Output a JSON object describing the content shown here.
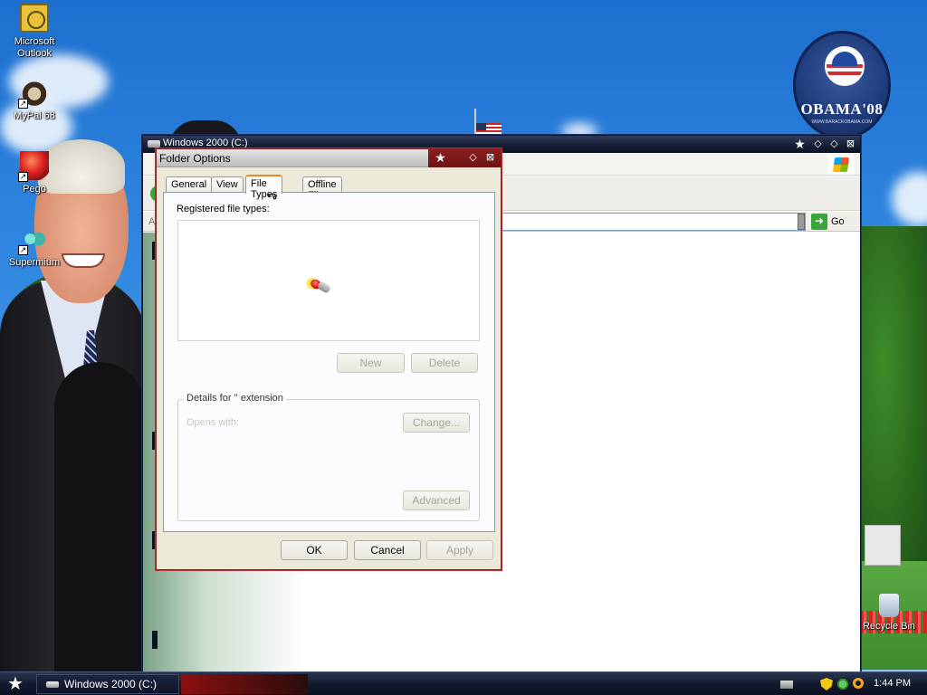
{
  "desktop": {
    "icons": [
      {
        "label": "Microsoft\nOutlook",
        "icon": "outlook-icon"
      },
      {
        "label": "MyPal 68",
        "icon": "mypal-icon"
      },
      {
        "label": "Pego",
        "icon": "pego-icon"
      },
      {
        "label": "Supermium",
        "icon": "supermium-icon"
      },
      {
        "label": "Recycle Bin",
        "icon": "recycle-bin-icon"
      }
    ],
    "badge": {
      "text": "OBAMA'08",
      "sub": "WWW.BARACKOBAMA.COM"
    }
  },
  "explorer": {
    "title": "Windows 2000 (C:)",
    "address_label": "Ad",
    "go_label": "Go"
  },
  "dialog": {
    "title": "Folder Options",
    "tabs": [
      "General",
      "View",
      "File Types",
      "Offline Files"
    ],
    "active_tab": "File Types",
    "registered_label": "Registered file types:",
    "new_button": "New",
    "delete_button": "Delete",
    "details_label": "Details for '' extension",
    "opens_with": "Opens with:",
    "change_button": "Change...",
    "advanced_button": "Advanced",
    "ok_button": "OK",
    "cancel_button": "Cancel",
    "apply_button": "Apply"
  },
  "taskbar": {
    "start_icon": "star-icon",
    "task_item": "Windows 2000 (C:)",
    "clock": "1:44 PM"
  },
  "colors": {
    "title_dark": "#151d33",
    "dialog_border": "#8b1a1a",
    "tab_active_accent": "#e68b2c",
    "desktop_sky": "#2f86e0"
  }
}
